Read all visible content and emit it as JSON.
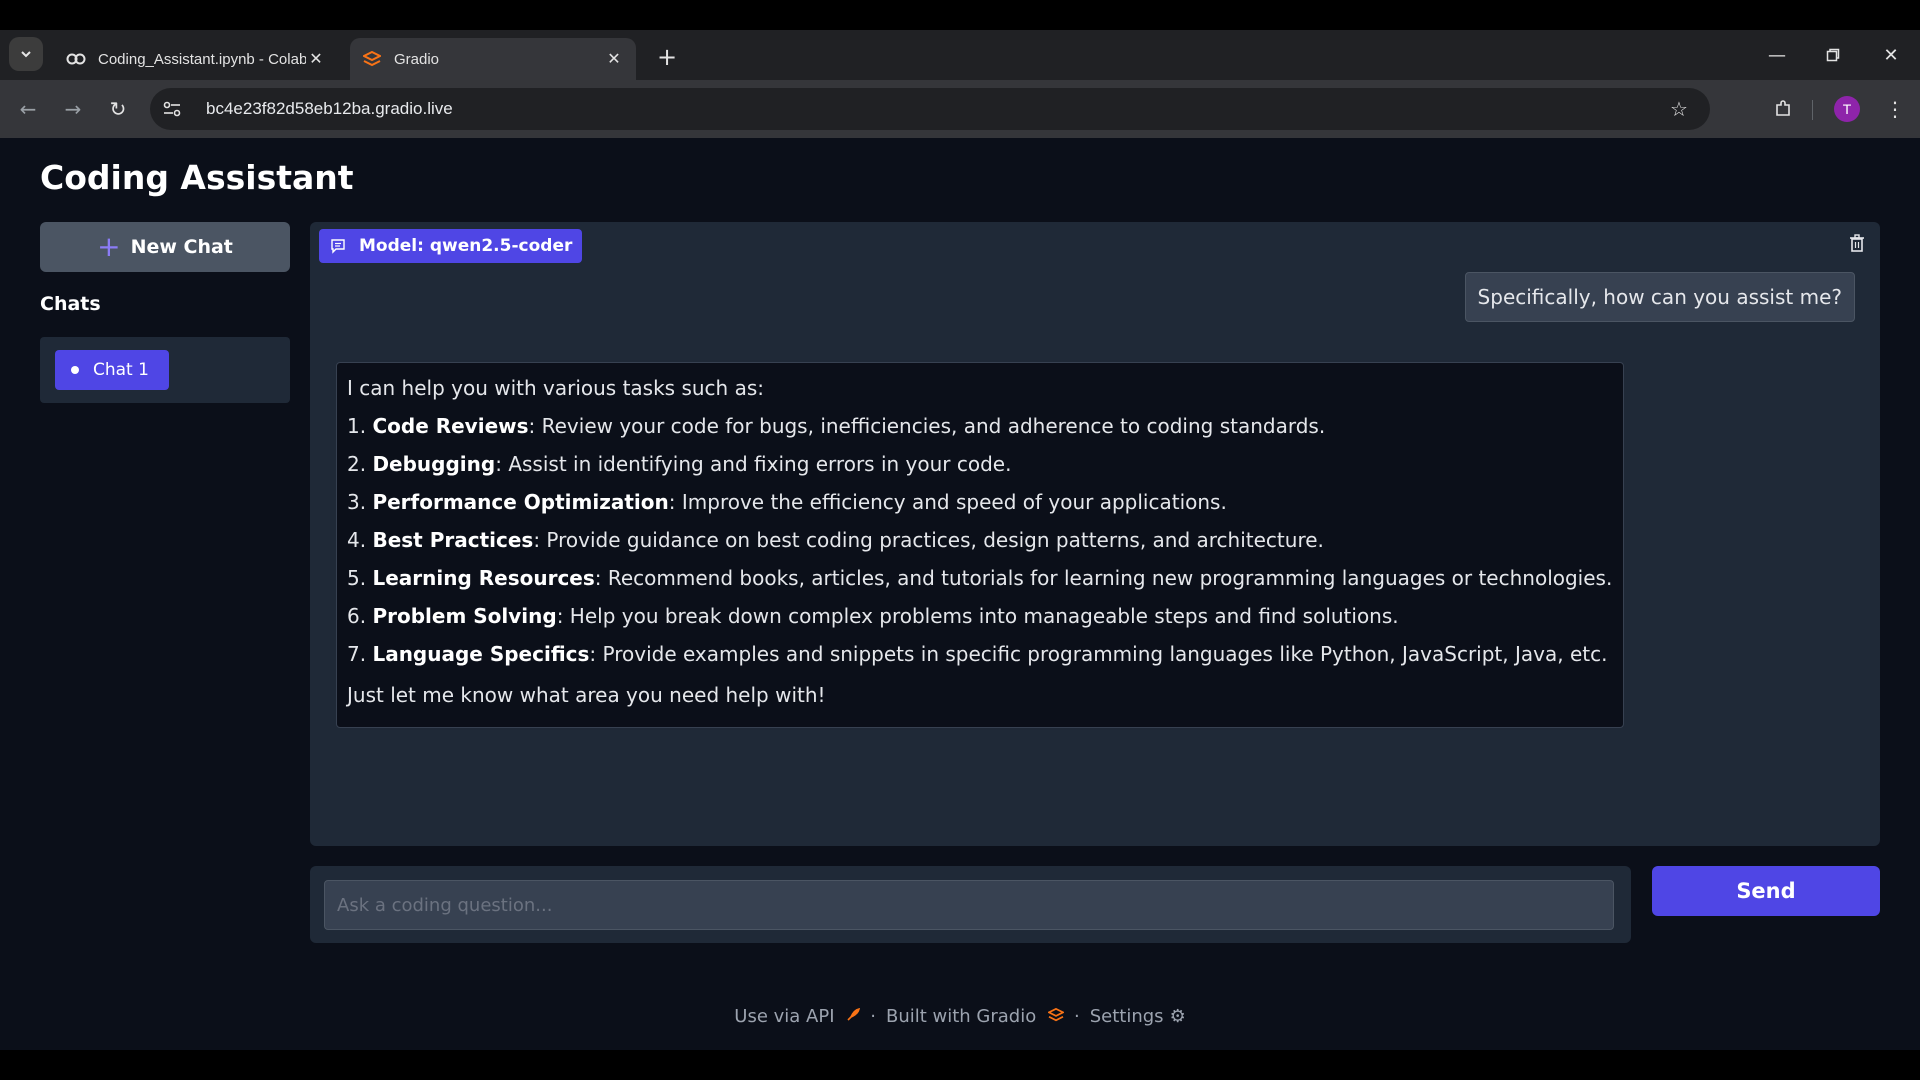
{
  "browser": {
    "tabs": [
      {
        "label": "Coding_Assistant.ipynb - Colab",
        "icon": "colab-icon"
      },
      {
        "label": "Gradio",
        "icon": "gradio-icon"
      }
    ],
    "url": "bc4e23f82d58eb12ba.gradio.live",
    "avatar_letter": "T"
  },
  "app": {
    "title": "Coding Assistant",
    "new_chat_label": "New Chat",
    "chats_label": "Chats",
    "chats": [
      {
        "label": "Chat 1"
      }
    ],
    "model_badge": "Model: qwen2.5-coder"
  },
  "conversation": {
    "user_message": "Specifically, how can you assist me?",
    "bot_intro": "I can help you with various tasks such as:",
    "bot_items": [
      {
        "num": "1.",
        "title": "Code Reviews",
        "text": ": Review your code for bugs, inefficiencies, and adherence to coding standards."
      },
      {
        "num": "2.",
        "title": "Debugging",
        "text": ": Assist in identifying and fixing errors in your code."
      },
      {
        "num": "3.",
        "title": "Performance Optimization",
        "text": ": Improve the efficiency and speed of your applications."
      },
      {
        "num": "4.",
        "title": "Best Practices",
        "text": ": Provide guidance on best coding practices, design patterns, and architecture."
      },
      {
        "num": "5.",
        "title": "Learning Resources",
        "text": ": Recommend books, articles, and tutorials for learning new programming languages or technologies."
      },
      {
        "num": "6.",
        "title": "Problem Solving",
        "text": ": Help you break down complex problems into manageable steps and find solutions."
      },
      {
        "num": "7.",
        "title": "Language Specifics",
        "text": ": Provide examples and snippets in specific programming languages like Python, JavaScript, Java, etc."
      }
    ],
    "bot_outro": "Just let me know what area you need help with!"
  },
  "input": {
    "placeholder": "Ask a coding question...",
    "value": "",
    "send_label": "Send"
  },
  "footer": {
    "api_label": "Use via API",
    "built_label": "Built with Gradio",
    "settings_label": "Settings",
    "separator": "·"
  },
  "colors": {
    "accent": "#4f46e5",
    "background": "#0b0f19",
    "panel": "#1f2937"
  }
}
